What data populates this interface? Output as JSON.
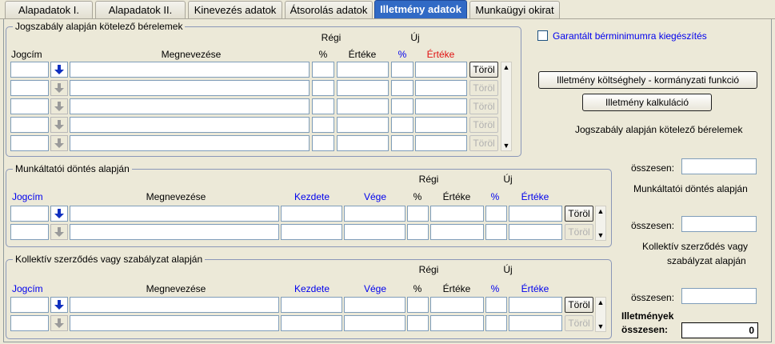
{
  "tabs": [
    {
      "label": "Alapadatok I."
    },
    {
      "label": "Alapadatok II."
    },
    {
      "label": "Kinevezés adatok"
    },
    {
      "label": "Átsorolás adatok"
    },
    {
      "label": "Illetmény adatok"
    },
    {
      "label": "Munkaügyi okirat"
    }
  ],
  "active_tab": "Illetmény adatok",
  "group1": {
    "legend": "Jogszabály alapján kötelező bérelemek",
    "regi": "Régi",
    "uj": "Új",
    "col_jogcim": "Jogcím",
    "col_megnevezese": "Megnevezése",
    "col_pct_old": "%",
    "col_ertek_old": "Értéke",
    "col_pct_new": "%",
    "col_ertek_new": "Értéke",
    "torol": "Töröl"
  },
  "group2": {
    "legend": "Munkáltatói döntés alapján",
    "regi": "Régi",
    "uj": "Új",
    "col_jogcim": "Jogcím",
    "col_megnevezese": "Megnevezése",
    "col_kezdete": "Kezdete",
    "col_vege": "Vége",
    "col_pct_old": "%",
    "col_ertek_old": "Értéke",
    "col_pct_new": "%",
    "col_ertek_new": "Értéke",
    "torol": "Töröl"
  },
  "group3": {
    "legend": "Kollektív szerződés vagy szabályzat alapján",
    "regi": "Régi",
    "uj": "Új",
    "col_jogcim": "Jogcím",
    "col_megnevezese": "Megnevezése",
    "col_kezdete": "Kezdete",
    "col_vege": "Vége",
    "col_pct_old": "%",
    "col_ertek_old": "Értéke",
    "col_pct_new": "%",
    "col_ertek_new": "Értéke",
    "torol": "Töröl"
  },
  "right": {
    "garantalt_label": "Garantált bérminimumra kiegészítés",
    "koltseghely_button": "Illetmény költséghely - kormányzati funkció",
    "kalkulacio_button": "Illetmény kalkuláció",
    "summary1_title": "Jogszabály alapján kötelező bérelemek",
    "osszesen": "összesen:",
    "summary2_title": "Munkáltatói döntés alapján",
    "summary3_title_line1": "Kollektív szerződés vagy",
    "summary3_title_line2": "szabályzat alapján",
    "total_label_line1": "Illetmények",
    "total_label_line2": "összesen:",
    "total_value": "0"
  },
  "colors": {
    "active_tab": "#316ac5",
    "blue_label": "#0000ee",
    "red_label": "#e01010",
    "background": "#ece9d8"
  },
  "icons": {
    "down_arrow": "arrow-down-icon",
    "scroll_up": "scroll-up-icon",
    "scroll_down": "scroll-down-icon"
  }
}
